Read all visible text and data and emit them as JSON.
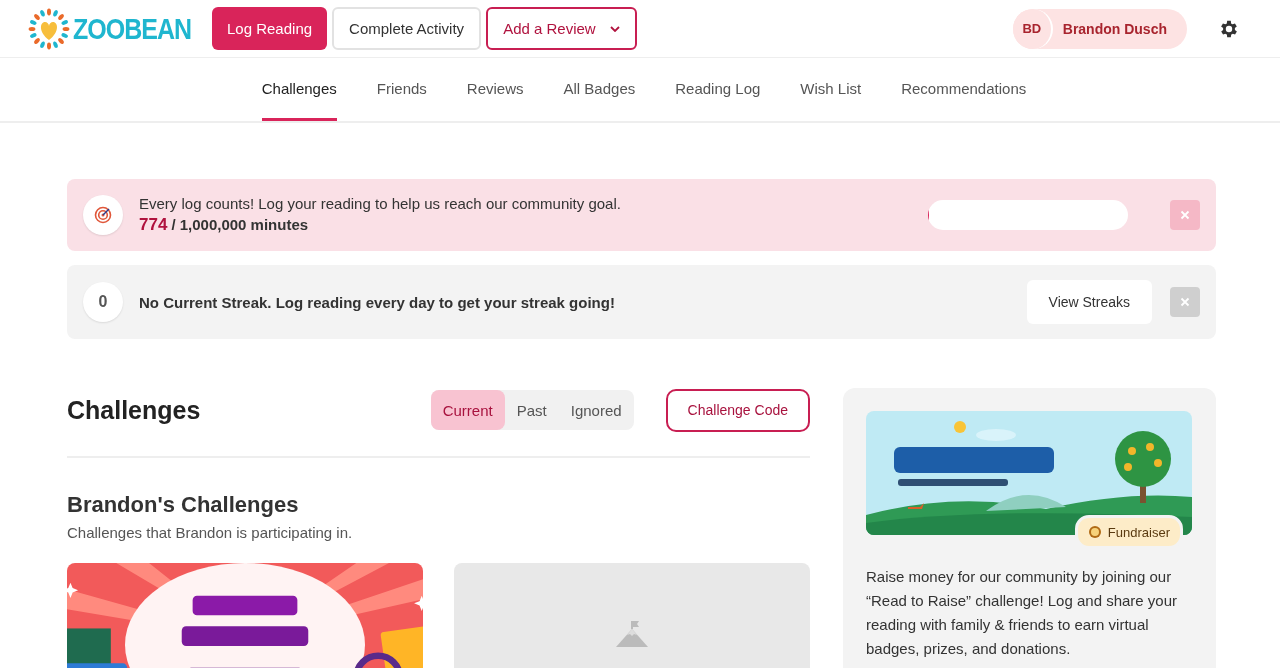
{
  "header": {
    "logo": "ZOOBEAN",
    "buttons": [
      {
        "label": "Log Reading",
        "kind": "primary"
      },
      {
        "label": "Complete Activity",
        "kind": "plain"
      },
      {
        "label": "Add a Review",
        "kind": "dropdown"
      }
    ],
    "user": {
      "initials": "BD",
      "name": "Brandon Dusch"
    }
  },
  "nav": [
    {
      "label": "Challenges",
      "selected": true
    },
    {
      "label": "Friends",
      "selected": false
    },
    {
      "label": "Reviews",
      "selected": false
    },
    {
      "label": "All Badges",
      "selected": false
    },
    {
      "label": "Reading Log",
      "selected": false
    },
    {
      "label": "Wish List",
      "selected": false
    },
    {
      "label": "Recommendations",
      "selected": false
    }
  ],
  "goal_banner": {
    "message": "Every log counts! Log your reading to help us reach our community goal.",
    "count": "774",
    "total": "/ 1,000,000 minutes",
    "level": 0.000774
  },
  "streak_banner": {
    "count": "0",
    "message": "No Current Streak. Log reading every day to get your streak going!",
    "button": "View Streaks"
  },
  "challenges": {
    "title": "Challenges",
    "filters": [
      {
        "label": "Current",
        "selected": true
      },
      {
        "label": "Past",
        "selected": false
      },
      {
        "label": "Ignored",
        "selected": false
      }
    ],
    "code_button": "Challenge Code",
    "section_title": "Brandon's Challenges",
    "section_subtitle": "Challenges that Brandon is participating in.",
    "cards": [
      {
        "kind": "picture"
      },
      {
        "kind": "placeholder"
      }
    ]
  },
  "promo": {
    "badge": "Fundraiser",
    "description": "Raise money for our community by joining our “Read to Raise” challenge! Log and share your reading with family & friends to earn virtual badges, prizes, and donations."
  }
}
